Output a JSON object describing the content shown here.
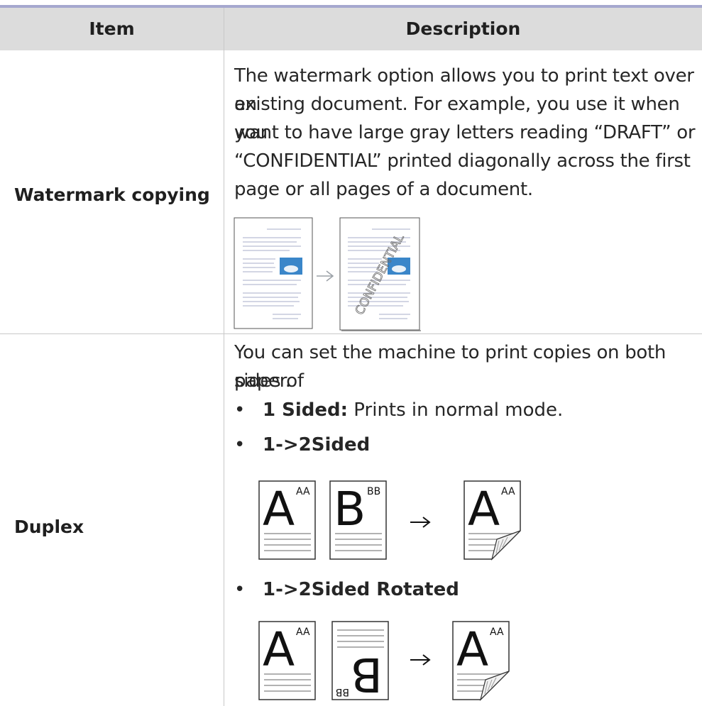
{
  "table": {
    "header": {
      "item": "Item",
      "description": "Description"
    },
    "rows": {
      "watermark": {
        "item": "Watermark copying",
        "description": [
          "The watermark option allows you to print text over an",
          "existing document. For example, you use it when you",
          "want to have large gray letters reading “DRAFT” or",
          "“CONFIDENTIAL” printed diagonally across the first",
          "page or all pages of a document."
        ],
        "illustration_text": "CONFIDENTIAL"
      },
      "duplex": {
        "item": "Duplex",
        "description": [
          "You can set the machine to print copies on both sides of",
          "paper."
        ],
        "options": [
          {
            "bullet": "•",
            "title": "1 Sided:",
            "text": " Prints in normal mode."
          },
          {
            "bullet": "•",
            "title": "1->2Sided",
            "text": ""
          },
          {
            "bullet": "•",
            "title": "1->2Sided Rotated",
            "text": ""
          }
        ],
        "page_letters": {
          "front": "A",
          "front_small": "AA",
          "back": "B",
          "back_small": "BB"
        }
      }
    }
  },
  "colors": {
    "top_rule": "#a6a8cf",
    "header_bg": "#dcdcdc",
    "rule": "#c8c8c8"
  }
}
